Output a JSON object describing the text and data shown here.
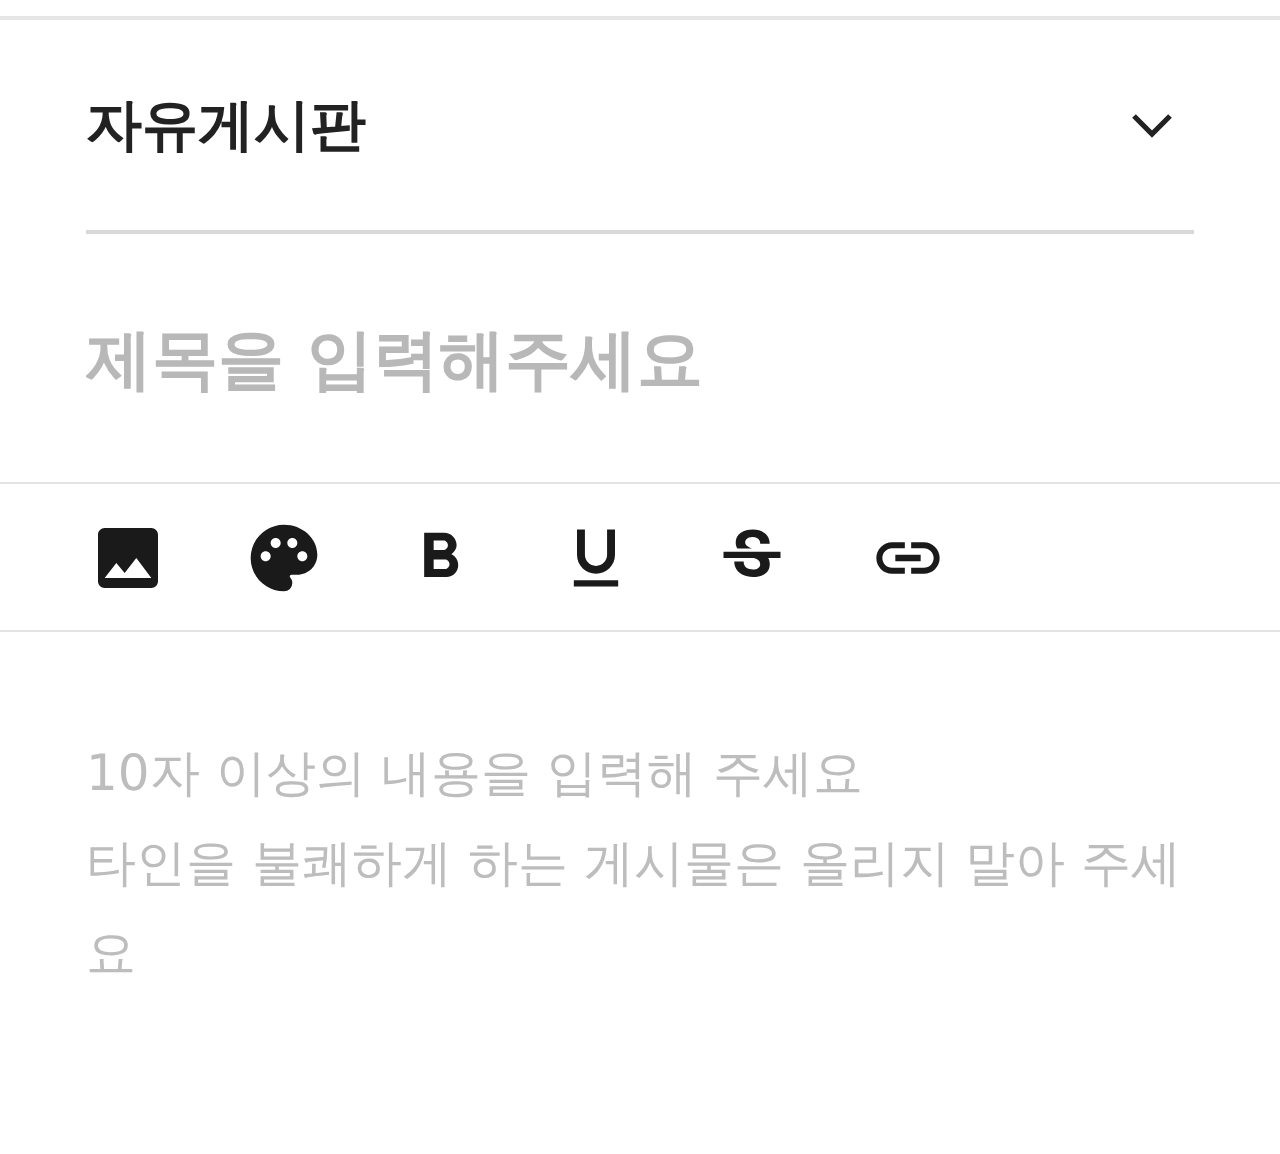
{
  "board": {
    "label": "자유게시판"
  },
  "title": {
    "placeholder": "제목을 입력해주세요"
  },
  "toolbar": [
    {
      "kind": "image"
    },
    {
      "kind": "palette"
    },
    {
      "kind": "bold"
    },
    {
      "kind": "underline"
    },
    {
      "kind": "strike"
    },
    {
      "kind": "link"
    }
  ],
  "body": {
    "placeholder": "10자 이상의 내용을 입력해 주세요\n타인을 불쾌하게 하는 게시물은 올리지 말아 주세요"
  }
}
